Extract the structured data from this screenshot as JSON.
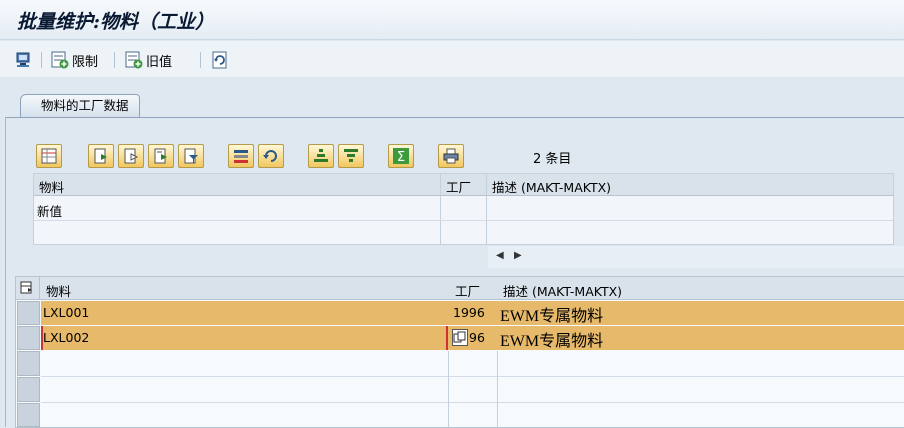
{
  "title": "批量维护:物料（工业）",
  "toolbar": {
    "limit_label": "限制",
    "old_value_label": "旧值"
  },
  "tabs": [
    {
      "label": "物料的工厂数据"
    }
  ],
  "count_text": "2 条目",
  "new_values_grid": {
    "headers": [
      "物料",
      "工厂",
      "描述 (MAKT-MAKTX)"
    ],
    "row_label": "新值"
  },
  "data_grid": {
    "headers": [
      "物料",
      "工厂",
      "描述 (MAKT-MAKTX)"
    ],
    "rows": [
      {
        "material": "LXL001",
        "plant": "1996",
        "description": "EWM专属物料"
      },
      {
        "material": "LXL002",
        "plant": "96",
        "description": "EWM专属物料"
      }
    ]
  },
  "colors": {
    "row_highlight": "#e7b96a",
    "accent": "#2a5a8a"
  },
  "icons": [
    "system-icon",
    "add-limit-icon",
    "add-old-value-icon",
    "refresh-icon",
    "details-icon",
    "select-all-icon",
    "deselect-all-icon",
    "edit-icon",
    "filter-icon",
    "multi-select-icon",
    "undo-icon",
    "sort-ascending-icon",
    "sort-descending-icon",
    "sum-icon",
    "print-icon",
    "copy-icon"
  ]
}
